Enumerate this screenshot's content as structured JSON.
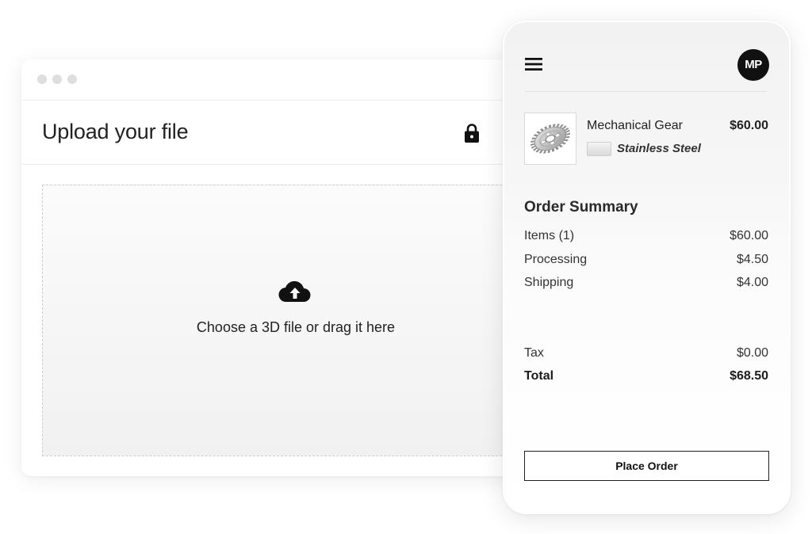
{
  "upload_window": {
    "title": "Upload your file",
    "dropzone_text": "Choose a 3D file or drag it here",
    "icons": [
      "lock-icon",
      "cloud-upload-icon"
    ]
  },
  "phone": {
    "avatar_initials": "MP",
    "product": {
      "name": "Mechanical Gear",
      "price": "$60.00",
      "material": "Stainless Steel",
      "thumbnail_icon": "gear-icon"
    },
    "order_summary": {
      "title": "Order Summary",
      "rows": [
        {
          "label": "Items (1)",
          "value": "$60.00"
        },
        {
          "label": "Processing",
          "value": "$4.50"
        },
        {
          "label": "Shipping",
          "value": "$4.00"
        },
        {
          "label": "Tax",
          "value": "$0.00"
        },
        {
          "label": "Total",
          "value": "$68.50"
        }
      ]
    },
    "place_order_label": "Place Order"
  },
  "colors": {
    "accent": "#111111",
    "background": "#ffffff",
    "dropzone": "#f3f3f3"
  }
}
